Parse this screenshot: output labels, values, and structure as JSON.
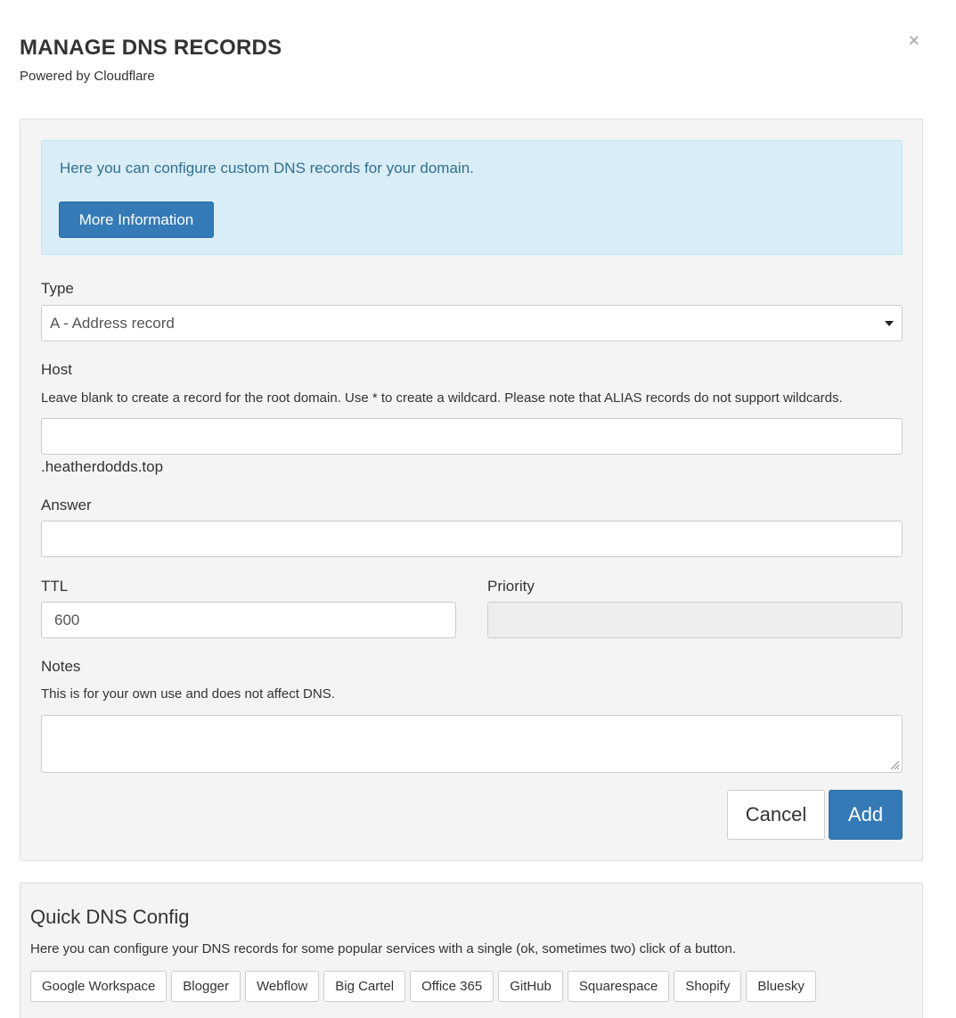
{
  "header": {
    "title": "MANAGE DNS RECORDS",
    "subtitle": "Powered by Cloudflare",
    "close_glyph": "×"
  },
  "info": {
    "text": "Here you can configure custom DNS records for your domain.",
    "button_label": "More Information"
  },
  "form": {
    "type_label": "Type",
    "type_value": "A - Address record",
    "host_label": "Host",
    "host_help": "Leave blank to create a record for the root domain. Use * to create a wildcard. Please note that ALIAS records do not support wildcards.",
    "host_value": "",
    "host_suffix": ".heatherdodds.top",
    "answer_label": "Answer",
    "answer_value": "",
    "ttl_label": "TTL",
    "ttl_value": "600",
    "priority_label": "Priority",
    "priority_value": "",
    "notes_label": "Notes",
    "notes_help": "This is for your own use and does not affect DNS.",
    "notes_value": "",
    "cancel_label": "Cancel",
    "add_label": "Add"
  },
  "quick": {
    "title": "Quick DNS Config",
    "help": "Here you can configure your DNS records for some popular services with a single (ok, sometimes two) click of a button.",
    "services": [
      "Google Workspace",
      "Blogger",
      "Webflow",
      "Big Cartel",
      "Office 365",
      "GitHub",
      "Squarespace",
      "Shopify",
      "Bluesky"
    ]
  },
  "colors": {
    "primary": "#337ab7",
    "info_bg": "#d9edf7",
    "info_text": "#31708f",
    "panel_bg": "#f4f4f4"
  }
}
